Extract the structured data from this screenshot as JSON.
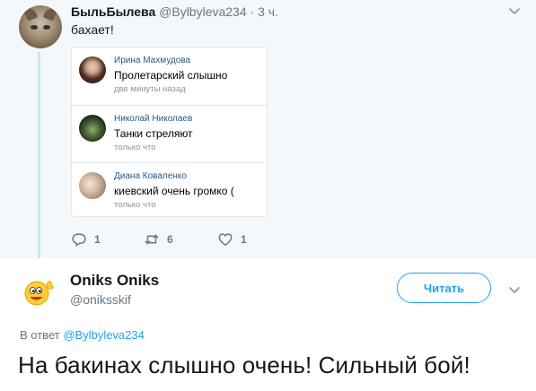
{
  "parent_tweet": {
    "display_name": "БыльБылева",
    "handle": "@Bylbyleva234",
    "separator": "·",
    "time": "3 ч.",
    "text": "бахает!",
    "comments": [
      {
        "author": "Ирина Махмудова",
        "text": "Пролетарский слышно",
        "time": "две минуты назад"
      },
      {
        "author": "Николай Николаев",
        "text": "Танки стреляют",
        "time": "только что"
      },
      {
        "author": "Диана Коваленко",
        "text": "киевский очень громко (",
        "time": "только что"
      }
    ],
    "actions": {
      "reply_count": "1",
      "retweet_count": "6",
      "like_count": "1"
    }
  },
  "main_tweet": {
    "display_name": "Oniks Oniks",
    "handle": "@oniksskif",
    "follow_label": "Читать",
    "reply_prefix": "В ответ",
    "reply_to": "@Bylbyleva234",
    "text": "На бакинах слышно очень! Сильный бой!"
  },
  "icons": {
    "chevron": "chevron-down-icon",
    "reply": "reply-icon",
    "retweet": "retweet-icon",
    "like": "heart-icon"
  },
  "colors": {
    "accent": "#1da1f2",
    "thread_line": "#cce4f3",
    "muted": "#657786",
    "parent_background": "#f5f8fa",
    "vk_link": "#2a5885"
  }
}
